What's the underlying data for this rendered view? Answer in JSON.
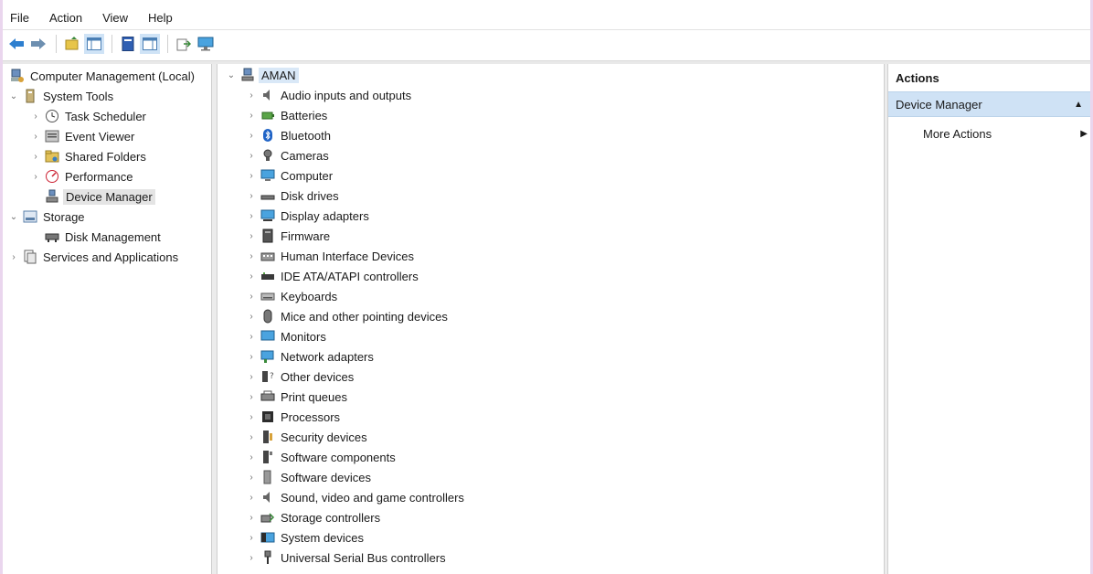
{
  "menu": [
    "File",
    "Action",
    "View",
    "Help"
  ],
  "toolbar": {
    "buttons": [
      "back-icon",
      "forward-icon",
      "up-folder-icon",
      "show-hide-tree-icon",
      "properties-icon",
      "help-pane-icon",
      "export-icon",
      "monitor-icon"
    ]
  },
  "tree": {
    "root": "Computer Management (Local)",
    "system_tools": "System Tools",
    "task_scheduler": "Task Scheduler",
    "event_viewer": "Event Viewer",
    "shared_folders": "Shared Folders",
    "performance": "Performance",
    "device_manager": "Device Manager",
    "storage": "Storage",
    "disk_management": "Disk Management",
    "services": "Services and Applications"
  },
  "devices": {
    "root": "AMAN",
    "categories": [
      "Audio inputs and outputs",
      "Batteries",
      "Bluetooth",
      "Cameras",
      "Computer",
      "Disk drives",
      "Display adapters",
      "Firmware",
      "Human Interface Devices",
      "IDE ATA/ATAPI controllers",
      "Keyboards",
      "Mice and other pointing devices",
      "Monitors",
      "Network adapters",
      "Other devices",
      "Print queues",
      "Processors",
      "Security devices",
      "Software components",
      "Software devices",
      "Sound, video and game controllers",
      "Storage controllers",
      "System devices",
      "Universal Serial Bus controllers"
    ]
  },
  "actions": {
    "title": "Actions",
    "section": "Device Manager",
    "more": "More Actions"
  },
  "colors": {
    "selection": "#d9e8f7",
    "actions_header": "#cfe2f5",
    "background": "#ead6ee"
  }
}
